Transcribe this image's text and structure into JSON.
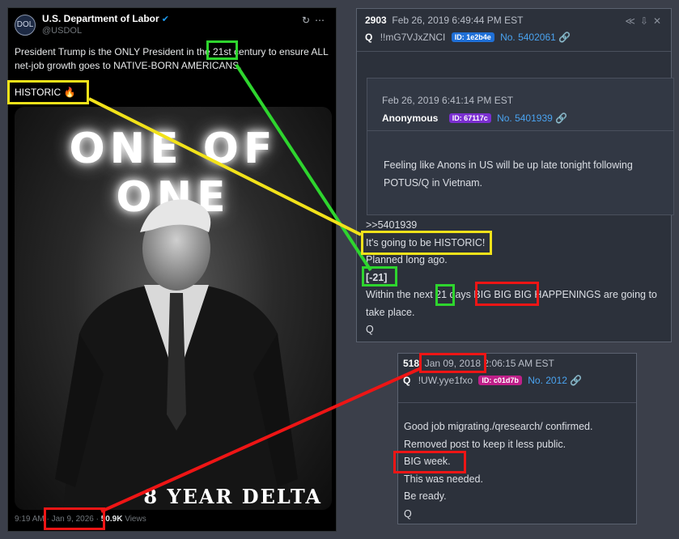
{
  "tweet": {
    "avatar_text": "DOL",
    "account_name": "U.S. Department of Labor",
    "handle": "@USDOL",
    "text": "President Trump is the ONLY President in the 21st century to ensure ALL net-job growth goes to NATIVE-BORN AMERICANS.",
    "historic": "HISTORIC 🔥",
    "image_title": "ONE OF ONE",
    "image_caption": "8 YEAR DELTA",
    "time": "9:19 AM",
    "date": "Jan 9, 2026",
    "views_count": "50.9K",
    "views_label": "Views"
  },
  "post1": {
    "number": "2903",
    "date": "Feb 26, 2019 6:49:44 PM EST",
    "author": "Q",
    "tripcode": "!!mG7VJxZNCI",
    "id_badge": "ID: 1e2b4e",
    "post_link": "No. 5402061",
    "quoted": {
      "date": "Feb 26, 2019 6:41:14 PM EST",
      "author": "Anonymous",
      "id_badge": "ID: 67117c",
      "post_link": "No. 5401939",
      "text_line1": "Feeling like Anons in US will be up late tonight following",
      "text_line2": "POTUS/Q in Vietnam."
    },
    "lines": [
      ">>5401939",
      "It's going to be HISTORIC!",
      "Planned long ago.",
      "[-21]",
      "Within the next 21 days BIG BIG BIG HAPPENINGS are going to",
      "take place.",
      "Q"
    ]
  },
  "post3": {
    "number": "518",
    "date": "Jan 09, 2018 2:06:15 AM EST",
    "author": "Q",
    "tripcode": "!UW.yye1fxo",
    "id_badge": "ID: c01d7b",
    "post_link": "No. 2012",
    "lines": [
      "Good job migrating./qresearch/ confirmed.",
      "Removed post to keep it less public.",
      "BIG week.",
      "This was needed.",
      "Be ready.",
      "Q"
    ]
  },
  "colors": {
    "page_bg": "#3b3f4a",
    "highlight_green": "#2ed52e",
    "highlight_yellow": "#f2e21a",
    "highlight_red": "#ee1515",
    "badge_blue": "#1f6fd6",
    "badge_purple": "#7b2fd1",
    "badge_pink": "#c0208a"
  }
}
